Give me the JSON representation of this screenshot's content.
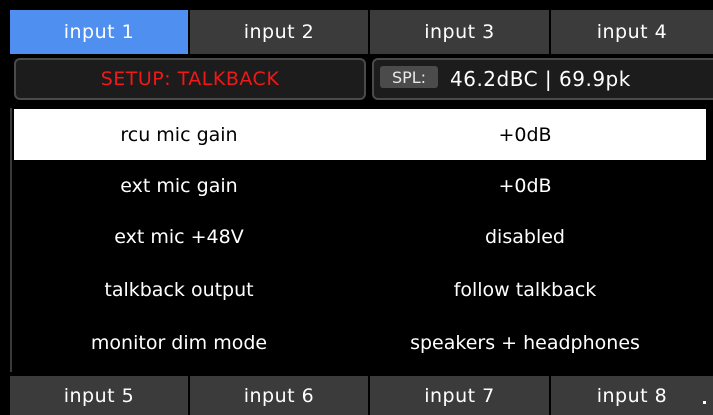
{
  "top_tabs": [
    "input 1",
    "input 2",
    "input 3",
    "input 4"
  ],
  "bottom_tabs": [
    "input 5",
    "input 6",
    "input 7",
    "input 8"
  ],
  "active_tab": "input 1",
  "header": {
    "title": "SETUP: TALKBACK",
    "spl_label": "SPL:",
    "spl_value": "46.2dBC | 69.9pk"
  },
  "settings": [
    {
      "label": "rcu mic gain",
      "value": "+0dB",
      "selected": true
    },
    {
      "label": "ext mic gain",
      "value": "+0dB",
      "selected": false
    },
    {
      "label": "ext mic +48V",
      "value": "disabled",
      "selected": false
    },
    {
      "label": "talkback output",
      "value": "follow talkback",
      "selected": false
    },
    {
      "label": "monitor dim mode",
      "value": "speakers + headphones",
      "selected": false
    }
  ],
  "colors": {
    "active_tab": "#4f8ff0",
    "tab": "#3b3b3b",
    "title": "#f01818",
    "background": "#000000"
  }
}
